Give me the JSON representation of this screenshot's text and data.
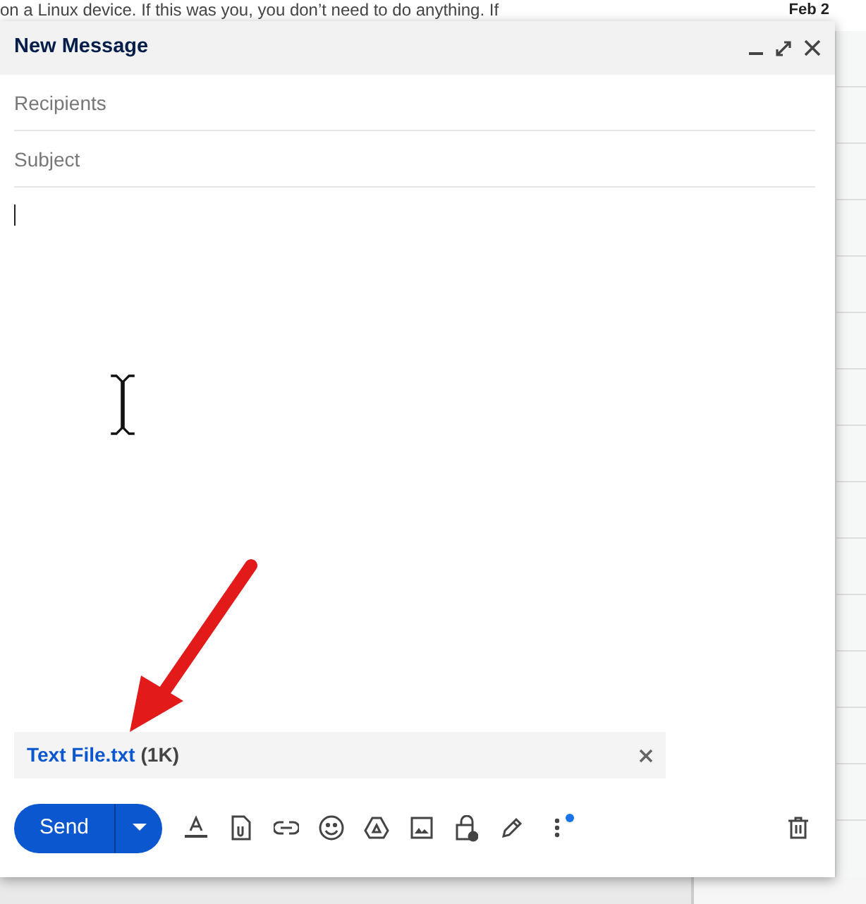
{
  "background": {
    "snippet": "on a Linux device. If this was you, you don’t need to do anything. If",
    "date": "Feb 2"
  },
  "compose": {
    "title": "New Message",
    "recipients": {
      "placeholder": "Recipients"
    },
    "subject": {
      "placeholder": "Subject"
    },
    "attachment": {
      "name": "Text File.txt",
      "size": "(1K)"
    },
    "send": {
      "label": "Send"
    },
    "more_notification": true
  }
}
